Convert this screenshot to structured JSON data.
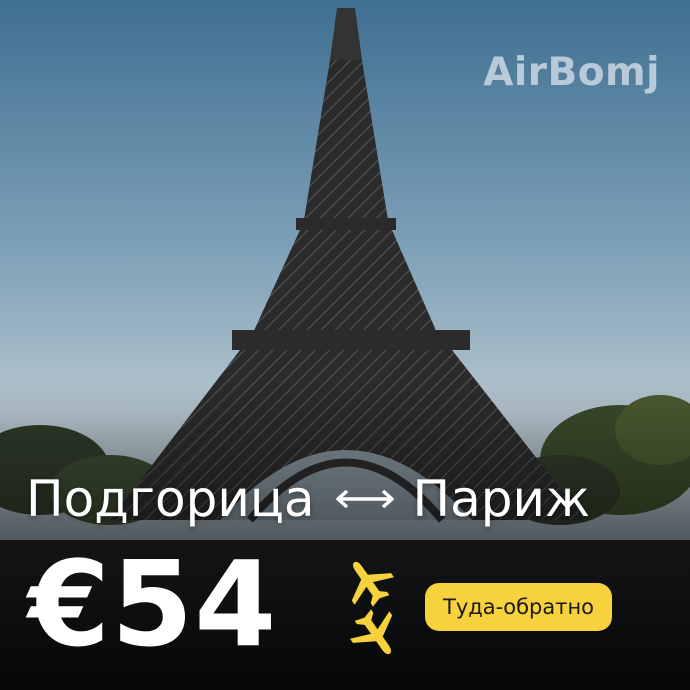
{
  "brand": {
    "name": "AirBomj"
  },
  "route": {
    "origin": "Подгорица",
    "destination": "Париж",
    "arrow_icon": "bidirectional-arrow-icon"
  },
  "offer": {
    "price": "€54",
    "trip_type": "Туда-обратно",
    "plane_icons": [
      "airplane-icon",
      "airplane-icon"
    ]
  },
  "colors": {
    "badge": "#f7d23c",
    "text": "#ffffff",
    "plane": "#f7d23c"
  }
}
